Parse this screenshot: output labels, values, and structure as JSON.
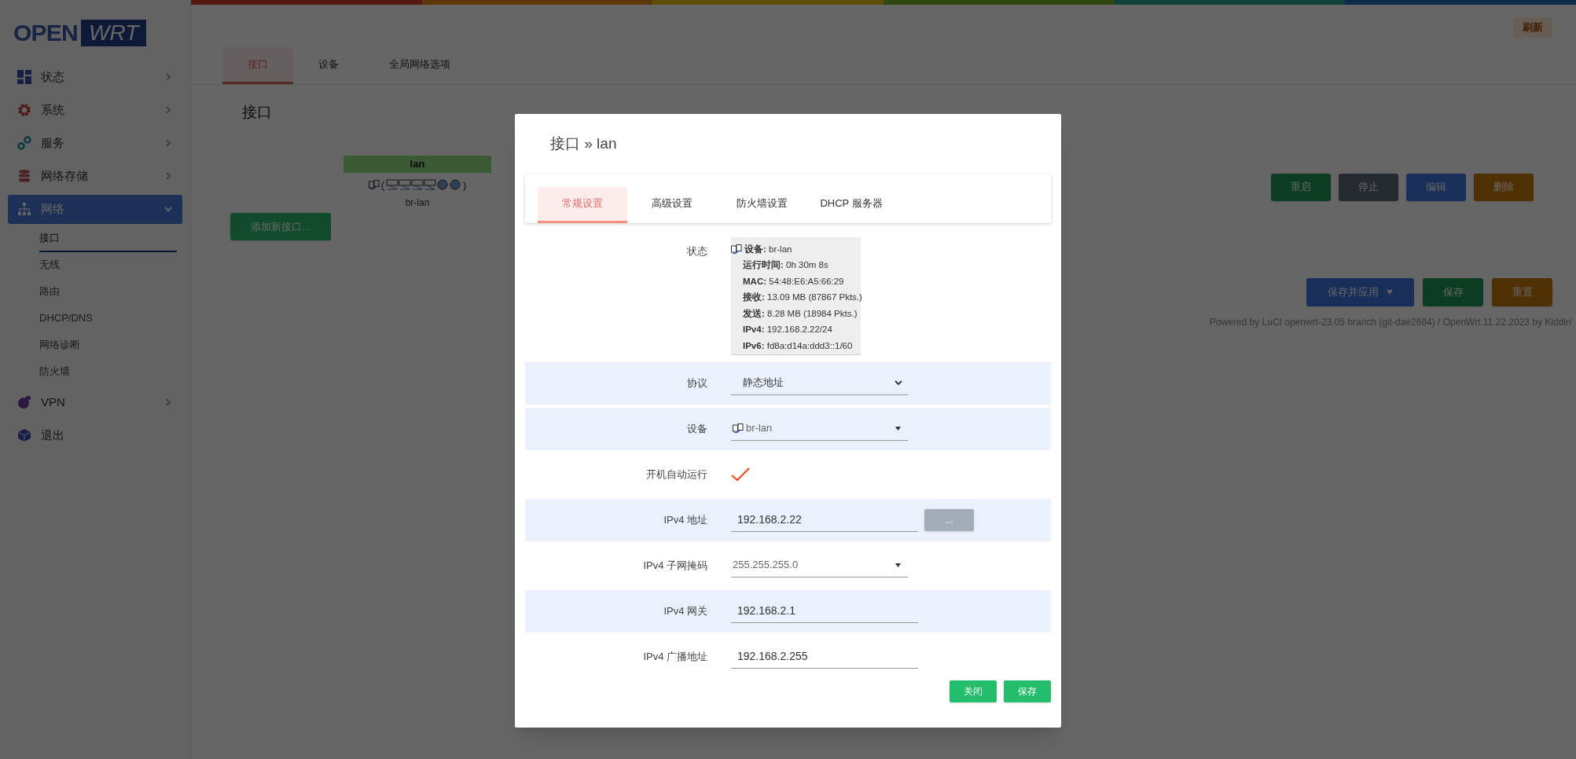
{
  "refresh_button": "刷新",
  "logo": {
    "part_1": "OPEN",
    "part_2": "WRT"
  },
  "sidebar": {
    "items": [
      {
        "label": "状态",
        "expanded": false,
        "selected": false
      },
      {
        "label": "系统",
        "expanded": false,
        "selected": false
      },
      {
        "label": "服务",
        "expanded": false,
        "selected": false
      },
      {
        "label": "网络存储",
        "expanded": false,
        "selected": false
      },
      {
        "label": "网络",
        "expanded": true,
        "selected": true,
        "children": [
          {
            "label": "接口",
            "selected": true
          },
          {
            "label": "无线",
            "selected": false
          },
          {
            "label": "路由",
            "selected": false
          },
          {
            "label": "DHCP/DNS",
            "selected": false
          },
          {
            "label": "网络诊断",
            "selected": false
          },
          {
            "label": "防火墙",
            "selected": false
          }
        ]
      },
      {
        "label": "VPN",
        "expanded": false,
        "selected": false
      },
      {
        "label": "退出",
        "selected": false
      }
    ]
  },
  "tabs": [
    {
      "label": "接口",
      "selected": true
    },
    {
      "label": "设备",
      "selected": false
    },
    {
      "label": "全局网络选项",
      "selected": false
    }
  ],
  "section_title": "接口",
  "interface": {
    "name": "lan",
    "brackets": [
      "(",
      ")"
    ],
    "device": "br-lan"
  },
  "interface_actions": [
    {
      "label": "重启",
      "kind": "positive"
    },
    {
      "label": "停止",
      "kind": "neutral"
    },
    {
      "label": "编辑",
      "kind": "action"
    },
    {
      "label": "删除",
      "kind": "negative"
    }
  ],
  "add_button": "添加新接口...",
  "page_actions": [
    {
      "label": "保存并应用",
      "kind": "action",
      "menu": true
    },
    {
      "label": "保存",
      "kind": "positive",
      "menu": false
    },
    {
      "label": "重置",
      "kind": "negative",
      "menu": false
    }
  ],
  "footer": "Powered by LuCI openwrt-23.05 branch (git-dae2684) / OpenWrt 11.22.2023 by Kiddin'",
  "dialog": {
    "title": "接口 » lan",
    "tabs": [
      {
        "label": "常规设置",
        "selected": true
      },
      {
        "label": "高级设置",
        "selected": false
      },
      {
        "label": "防火墙设置",
        "selected": false
      },
      {
        "label": "DHCP 服务器",
        "selected": false
      }
    ],
    "status": {
      "label": "状态",
      "lines": [
        {
          "key": "设备:",
          "value": "br-lan"
        },
        {
          "key": "运行时间:",
          "value": "0h 30m 8s"
        },
        {
          "key": "MAC:",
          "value": "54:48:E6:A5:66:29"
        },
        {
          "key": "接收:",
          "value": "13.09 MB (87867 Pkts.)"
        },
        {
          "key": "发送:",
          "value": "8.28 MB (18984 Pkts.)"
        },
        {
          "key": "IPv4:",
          "value": "192.168.2.22/24"
        },
        {
          "key": "IPv6:",
          "value": "fd8a:d14a:ddd3::1/60"
        }
      ]
    },
    "fields": [
      {
        "label": "协议",
        "kind": "select",
        "value": "静态地址",
        "shaded": true
      },
      {
        "label": "设备",
        "kind": "device",
        "value": "br-lan",
        "shaded": true
      },
      {
        "label": "开机自动运行",
        "kind": "checkbox",
        "checked": true,
        "shaded": false
      },
      {
        "label": "IPv4 地址",
        "kind": "input",
        "value": "192.168.2.22",
        "button": "...",
        "shaded": true
      },
      {
        "label": "IPv4 子网掩码",
        "kind": "dropdown",
        "value": "255.255.255.0",
        "shaded": false
      },
      {
        "label": "IPv4 网关",
        "kind": "input",
        "value": "192.168.2.1",
        "shaded": true
      },
      {
        "label": "IPv4 广播地址",
        "kind": "input",
        "value": "192.168.2.255",
        "shaded": false
      }
    ],
    "buttons": [
      "关闭",
      "保存"
    ]
  }
}
